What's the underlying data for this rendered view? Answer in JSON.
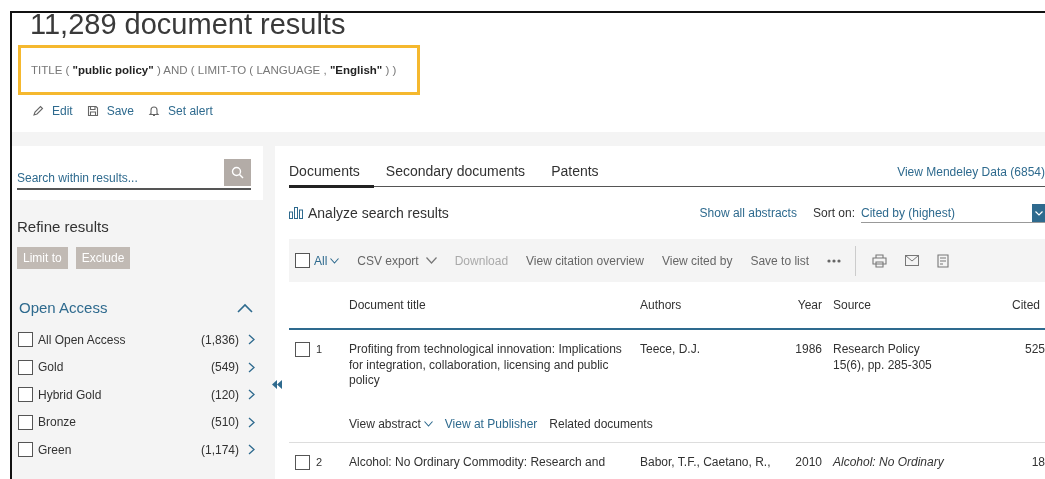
{
  "header": {
    "title": "11,289 document results",
    "query": "TITLE ( **\"public policy\"** ) AND  ( LIMIT-TO ( LANGUAGE ,  **\"English\"** ) )",
    "actions": [
      {
        "label": "Edit",
        "kind": "edit"
      },
      {
        "label": "Save",
        "kind": "save"
      },
      {
        "label": "Set alert",
        "kind": "alert"
      }
    ]
  },
  "sidebar": {
    "search": {
      "placeholder": "Search within results..."
    },
    "refine_title": "Refine results",
    "buttons": [
      {
        "label": "Limit to",
        "disabled": true
      },
      {
        "label": "Exclude",
        "disabled": true
      }
    ],
    "facet": {
      "title": "Open Access",
      "expanded": true,
      "items": [
        {
          "label": "All Open Access",
          "count": "(1,836)",
          "checked": false
        },
        {
          "label": "Gold",
          "count": "(549)",
          "checked": false
        },
        {
          "label": "Hybrid Gold",
          "count": "(120)",
          "checked": false
        },
        {
          "label": "Bronze",
          "count": "(510)",
          "checked": false
        },
        {
          "label": "Green",
          "count": "(1,174)",
          "checked": false
        }
      ]
    }
  },
  "main": {
    "tabs": [
      {
        "label": "Documents",
        "selected": true
      },
      {
        "label": "Secondary documents",
        "selected": false
      },
      {
        "label": "Patents",
        "selected": false
      }
    ],
    "mendeley_link": "View Mendeley Data (6854)",
    "analyze": "Analyze search results",
    "show_all": "Show all abstracts",
    "sort": {
      "label": "Sort on:",
      "value": "Cited by (highest)"
    },
    "toolbar": {
      "select_all": {
        "label": "All",
        "checked": false
      },
      "actions": [
        {
          "label": "CSV export",
          "kind": "dropdown",
          "disabled": false
        },
        {
          "label": "Download",
          "kind": "plain",
          "disabled": true
        },
        {
          "label": "View citation overview",
          "kind": "plain",
          "disabled": false
        },
        {
          "label": "View cited by",
          "kind": "plain",
          "disabled": false
        },
        {
          "label": "Save to list",
          "kind": "plain",
          "disabled": false
        }
      ]
    },
    "table": {
      "columns": [
        "Document title",
        "Authors",
        "Year",
        "Source",
        "Cited"
      ],
      "rows": [
        {
          "number": "1",
          "checked": false,
          "title": "Profiting from technological innovation: Implications for integration, collaboration, licensing and public policy",
          "authors": "Teece, D.J.",
          "year": "1986",
          "source": "Research Policy",
          "source_detail": "15(6), pp. 285-305",
          "source_italic": false,
          "cited": "525",
          "links": [
            {
              "label": "View abstract",
              "kind": "dropdown"
            },
            {
              "label": "View at Publisher",
              "kind": "link"
            },
            {
              "label": "Related documents",
              "kind": "plain"
            }
          ]
        },
        {
          "number": "2",
          "checked": false,
          "title": "Alcohol: No Ordinary Commodity: Research and",
          "authors": "Babor, T.F., Caetano, R.,",
          "year": "2010",
          "source": "Alcohol: No Ordinary",
          "source_italic": true,
          "cited": "18"
        }
      ]
    }
  }
}
